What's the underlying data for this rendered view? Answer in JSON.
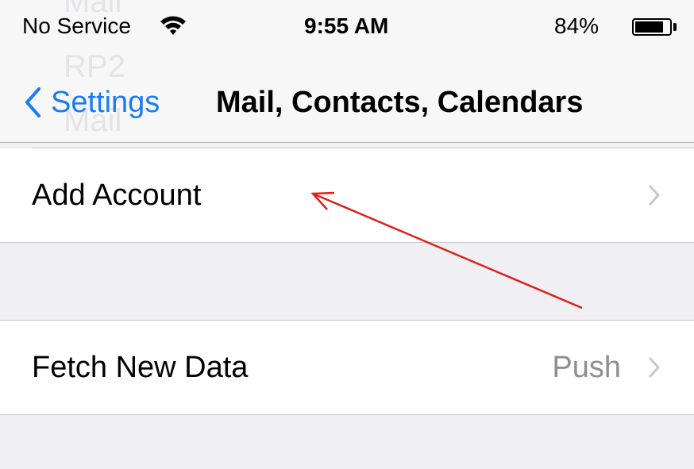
{
  "background_text": {
    "top": "Mail",
    "account_name": "RP2",
    "account_type": "Mail"
  },
  "status_bar": {
    "carrier": "No Service",
    "time": "9:55 AM",
    "battery": "84%",
    "battery_level": 0.84
  },
  "nav": {
    "back_label": "Settings",
    "title": "Mail, Contacts, Calendars"
  },
  "cells": [
    {
      "label": "Add Account",
      "value": ""
    },
    {
      "label": "Fetch New Data",
      "value": "Push"
    }
  ],
  "colors": {
    "accent": "#1a7cf5",
    "annotation_arrow": "#e0201a"
  },
  "icons": {
    "wifi": "wifi-icon",
    "battery": "battery-icon",
    "back": "chevron-left-icon",
    "disclosure": "chevron-right-icon"
  }
}
